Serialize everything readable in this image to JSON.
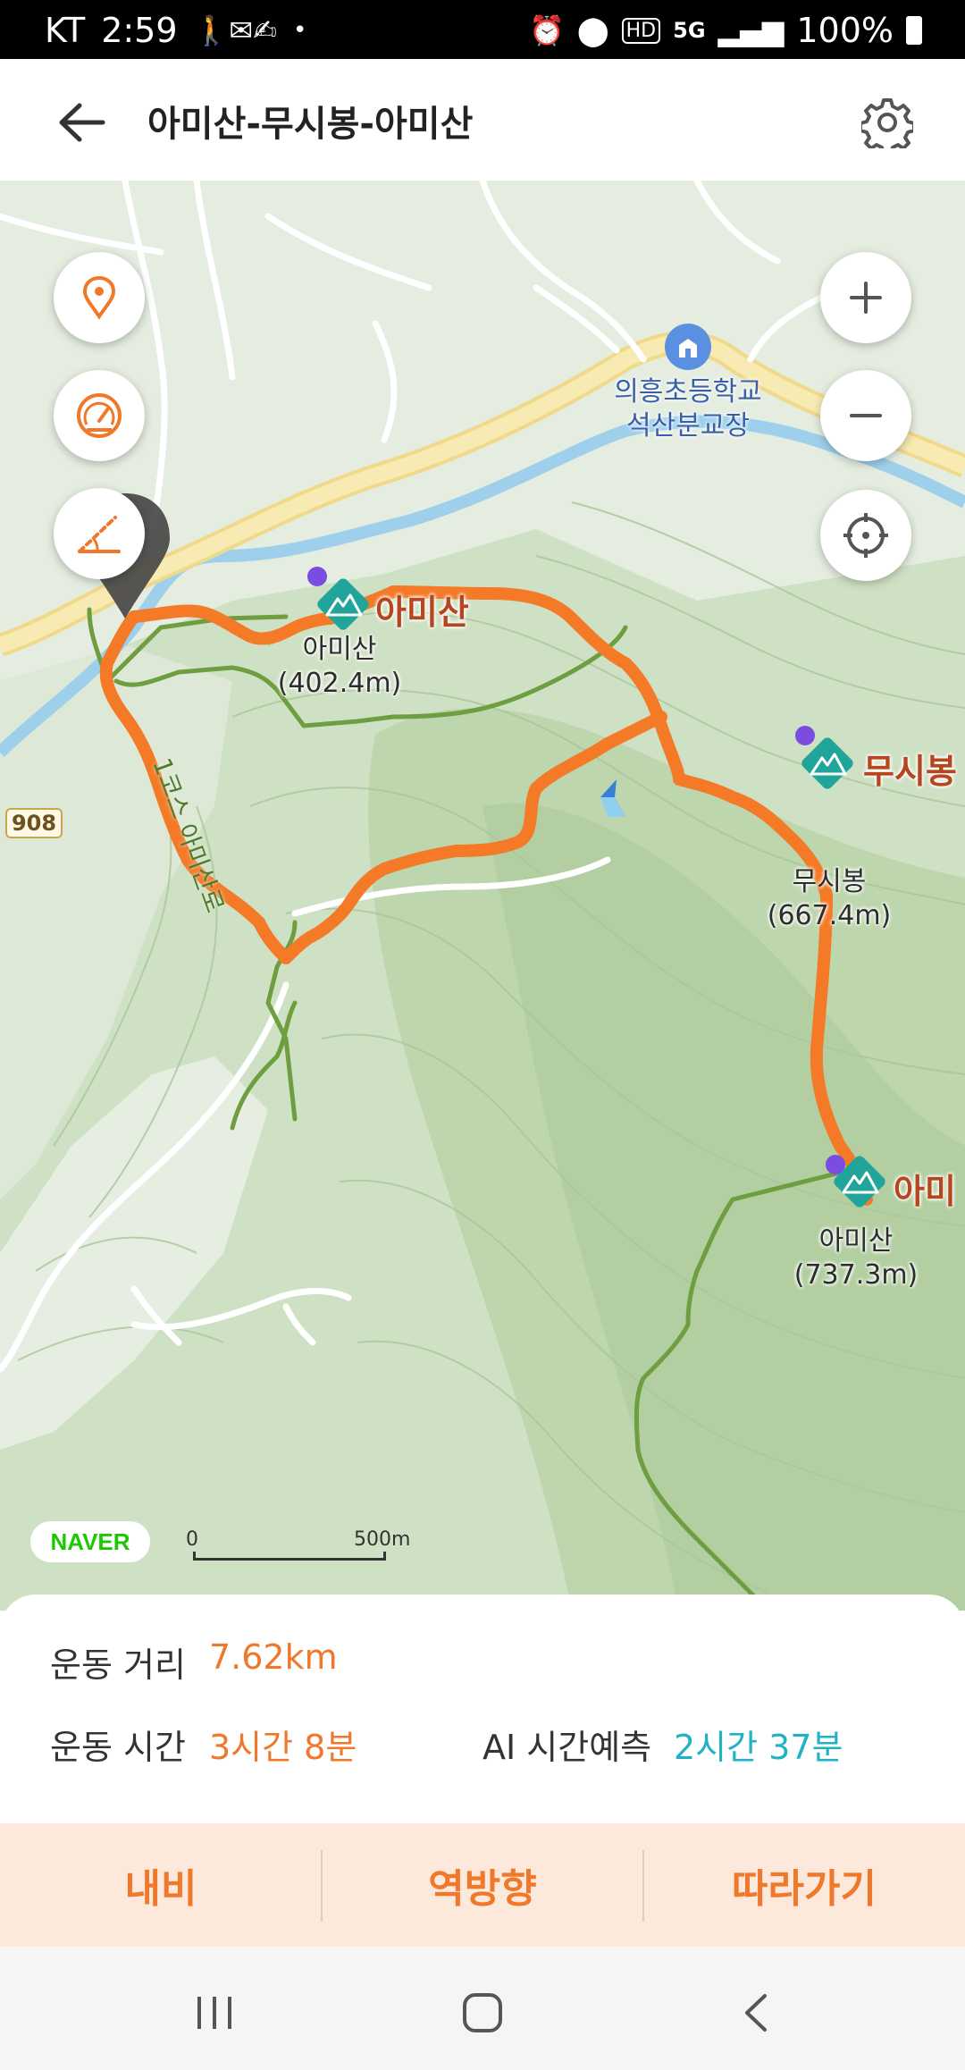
{
  "status_bar": {
    "carrier": "KT",
    "time": "2:59",
    "dot": "•",
    "network": "5G",
    "hd": "HD",
    "battery": "100%"
  },
  "header": {
    "title": "아미산-무시봉-아미산"
  },
  "map": {
    "peaks": [
      {
        "name": "아미산",
        "sub_name": "아미산",
        "elevation": "(402.4m)"
      },
      {
        "name": "무시봉",
        "sub_name": "무시봉",
        "elevation": "(667.4m)"
      },
      {
        "name": "아미",
        "sub_name": "아미산",
        "elevation": "(737.3m)"
      }
    ],
    "school": {
      "line1": "의흥초등학교",
      "line2": "석산분교장"
    },
    "road_number": "908",
    "trail_label": "1코스 아미산로",
    "provider": "NAVER",
    "scale": {
      "zero": "0",
      "max": "500m"
    },
    "colors": {
      "route": "#f47a28",
      "trail": "#6e9e40",
      "water": "#9ed0ec",
      "road": "#f5e6a0"
    }
  },
  "info": {
    "distance_label": "운동 거리",
    "distance_value": "7.62km",
    "duration_label": "운동 시간",
    "duration_value": "3시간 8분",
    "ai_label": "AI 시간예측",
    "ai_value": "2시간 37분",
    "colors": {
      "value_orange": "#f0782b",
      "value_teal": "#22b2c6"
    }
  },
  "actions": {
    "navigate": "내비",
    "reverse": "역방향",
    "follow": "따라가기"
  }
}
